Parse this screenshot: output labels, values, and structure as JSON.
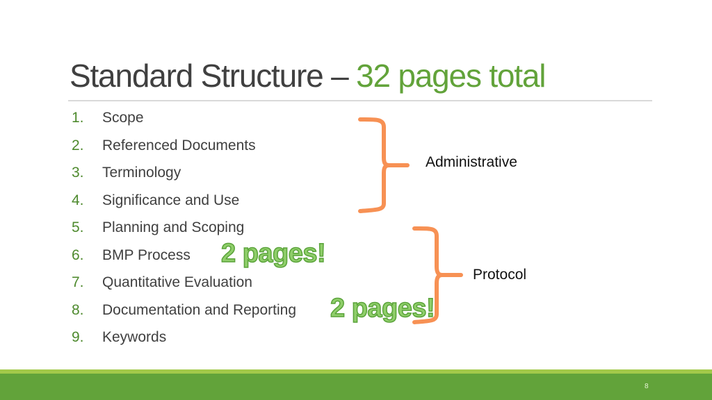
{
  "slide": {
    "title_main": "Standard Structure – ",
    "title_accent": "32 pages total",
    "sections": [
      {
        "num": "1.",
        "label": "Scope"
      },
      {
        "num": "2.",
        "label": "Referenced Documents"
      },
      {
        "num": "3.",
        "label": "Terminology"
      },
      {
        "num": "4.",
        "label": "Significance and Use"
      },
      {
        "num": "5.",
        "label": "Planning and Scoping"
      },
      {
        "num": "6.",
        "label": "BMP Process"
      },
      {
        "num": "7.",
        "label": "Quantitative Evaluation"
      },
      {
        "num": "8.",
        "label": "Documentation and Reporting"
      },
      {
        "num": "9.",
        "label": "Keywords"
      }
    ],
    "callouts": [
      "2 pages!",
      "2 pages!"
    ],
    "groups": {
      "administrative": "Administrative",
      "protocol": "Protocol"
    },
    "page_number": "8"
  },
  "colors": {
    "accent_green": "#62a33a",
    "brace_orange": "#f79154",
    "footer_light": "#a2c94a"
  }
}
